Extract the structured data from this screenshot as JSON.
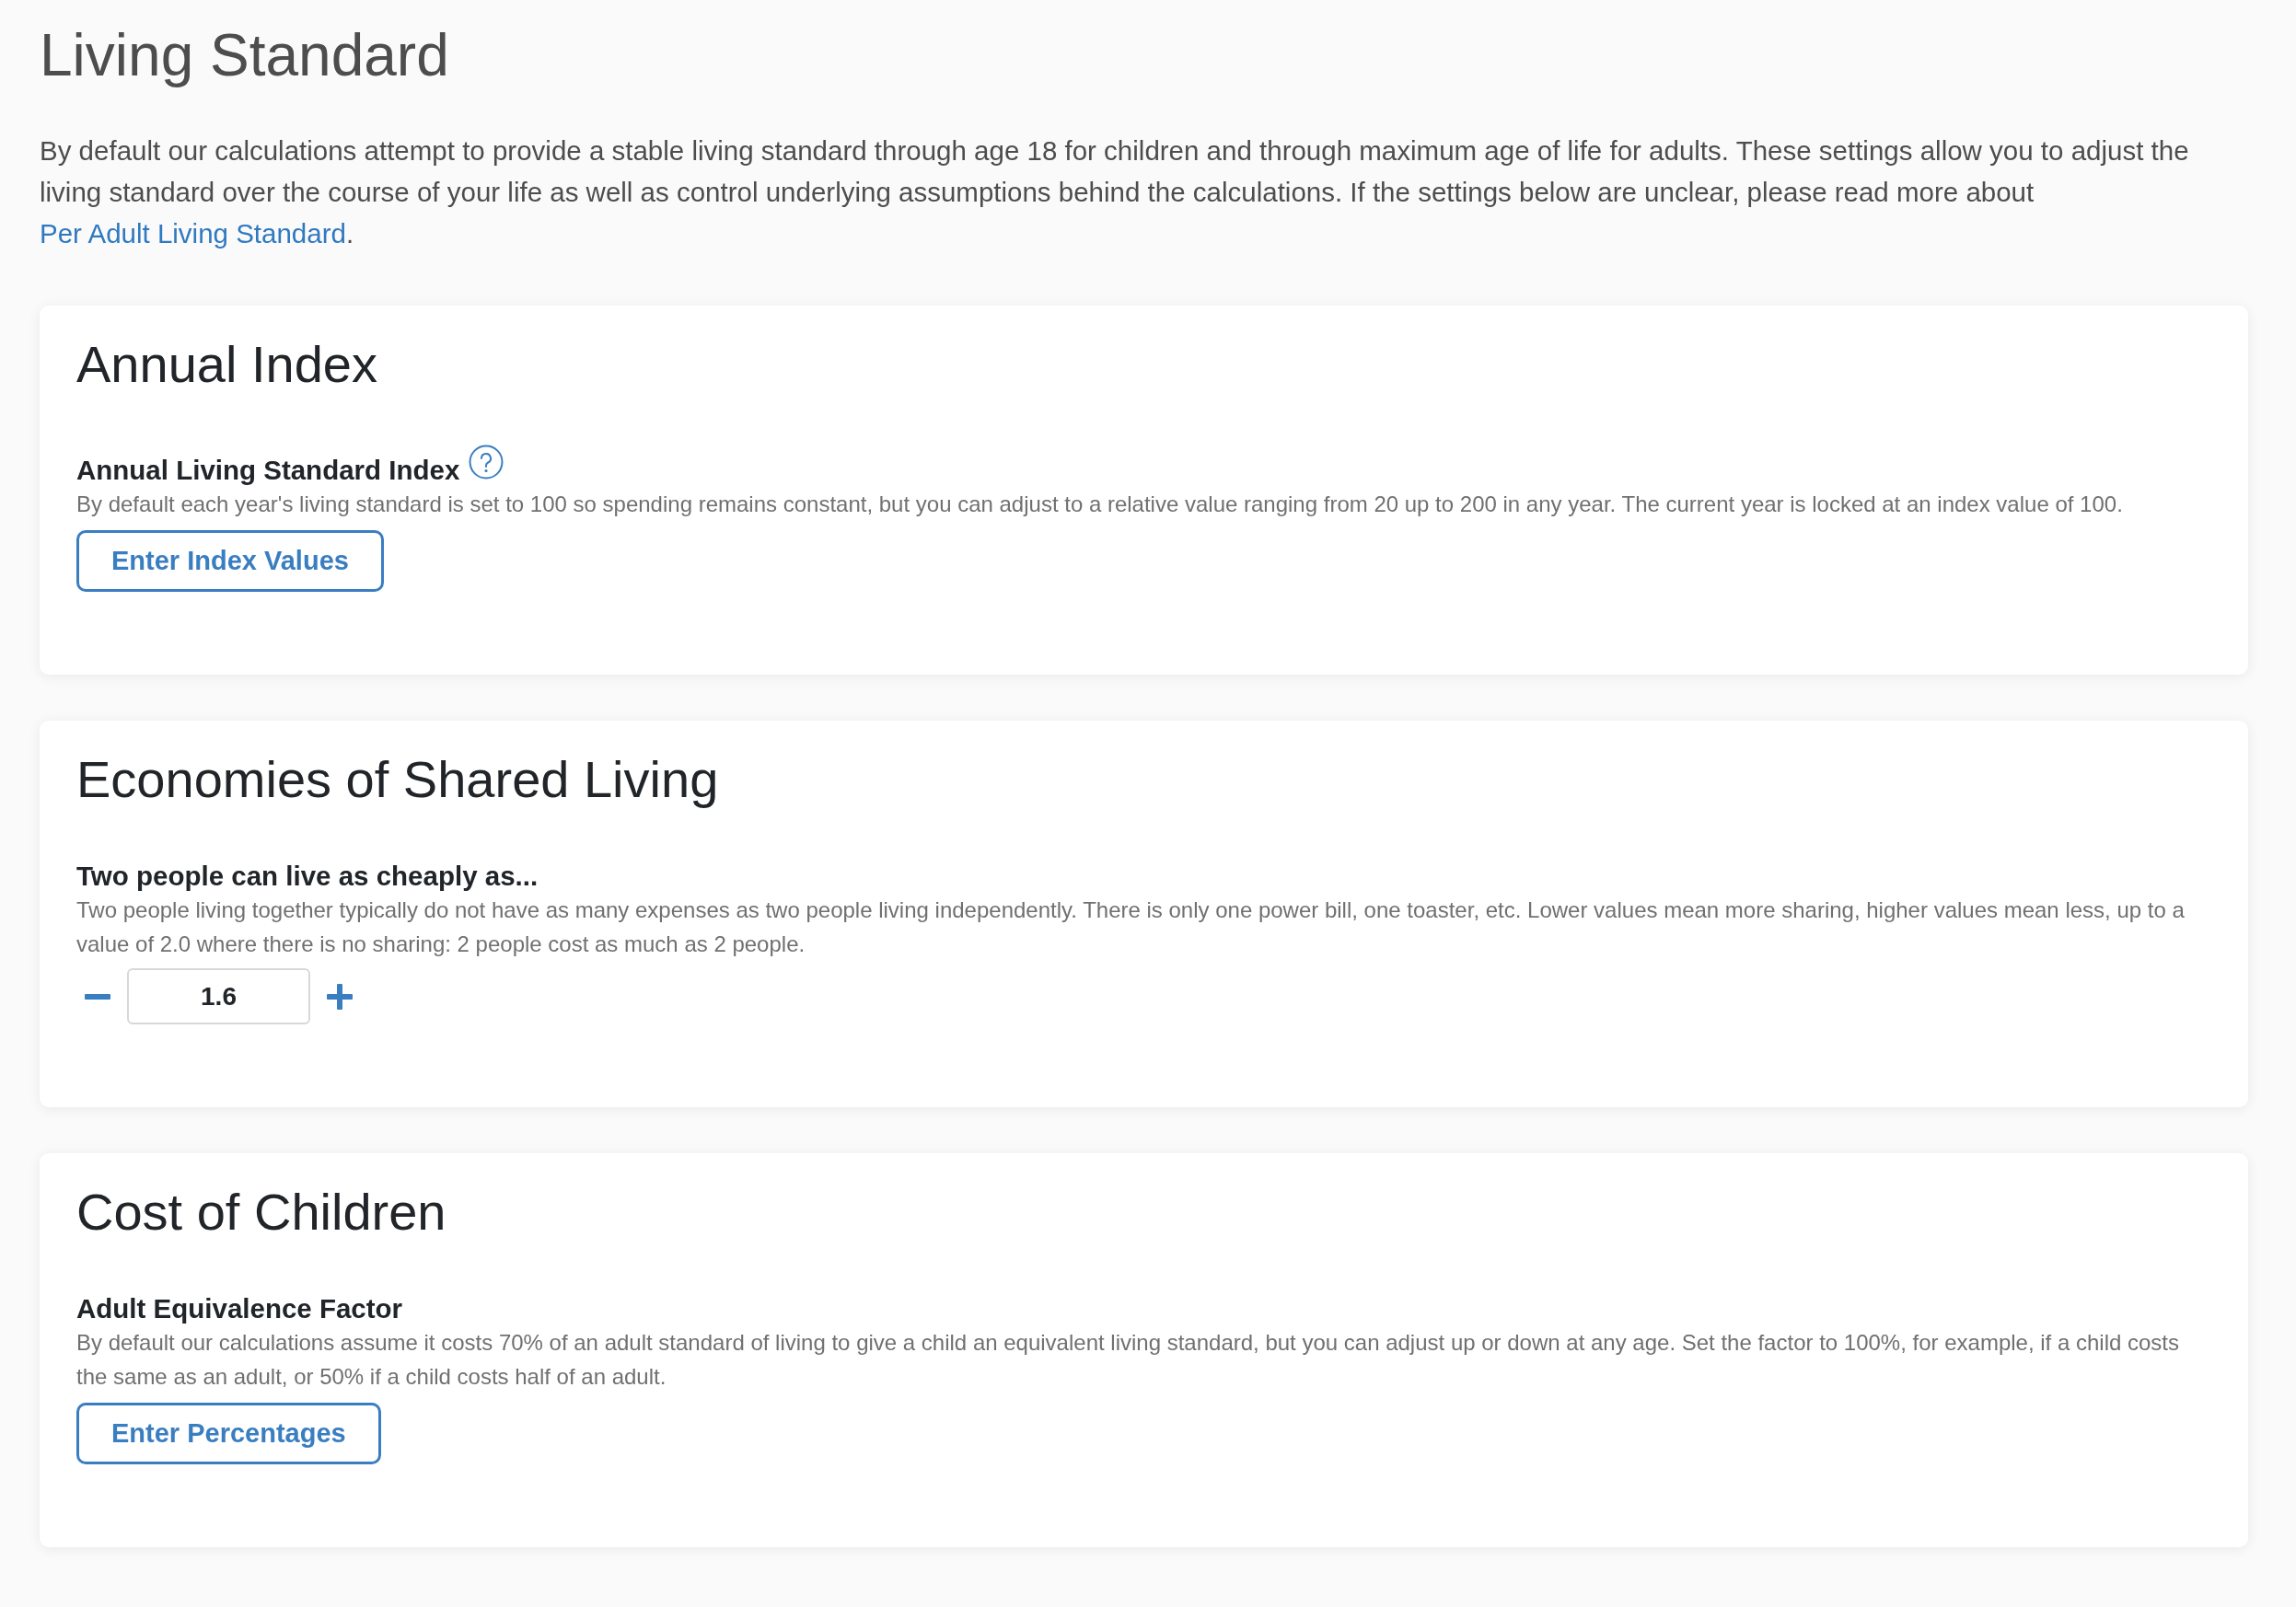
{
  "page": {
    "title": "Living Standard",
    "intro": {
      "text_before": "By default our calculations attempt to provide a stable living standard through age 18 for children and through maximum age of life for adults. These settings allow you to adjust the living standard over the course of your life as well as control underlying assumptions behind the calculations. If the settings below are unclear, please read more about",
      "link": "Per Adult Living Standard",
      "text_after": "."
    }
  },
  "sections": [
    {
      "title": "Annual Index",
      "setting": {
        "kind": "button",
        "label": "Annual Living Standard Index",
        "has_help": true,
        "description": "By default each year's living standard is set to 100 so spending remains constant, but you can adjust to a relative value ranging from 20 up to 200 in any year. The current year is locked at an index value of 100.",
        "button": "Enter Index Values"
      }
    },
    {
      "title": "Economies of Shared Living",
      "setting": {
        "kind": "stepper",
        "label": "Two people can live as cheaply as...",
        "has_help": false,
        "description": "Two people living together typically do not have as many expenses as two people living independently. There is only one power bill, one toaster, etc. Lower values mean more sharing, higher values mean less, up to a value of 2.0 where there is no sharing: 2 people cost as much as 2 people.",
        "value": "1.6"
      }
    },
    {
      "title": "Cost of Children",
      "setting": {
        "kind": "button",
        "label": "Adult Equivalence Factor",
        "has_help": false,
        "description": "By default our calculations assume it costs 70% of an adult standard of living to give a child an equivalent living standard, but you can adjust up or down at any age. Set the factor to 100%, for example, if a child costs the same as an adult, or 50% if a child costs half of an adult.",
        "button": "Enter Percentages"
      }
    }
  ]
}
